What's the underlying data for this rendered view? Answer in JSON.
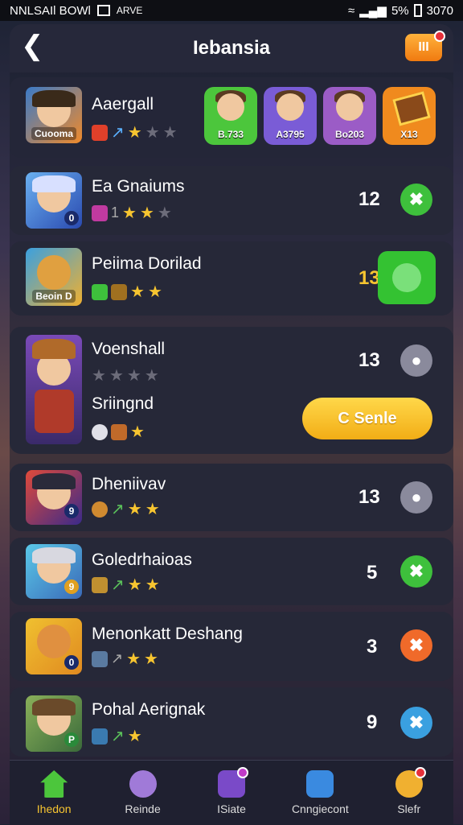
{
  "status_bar": {
    "left_text": "NNLSAIl BOWl",
    "small_text": "ARVE",
    "battery": "5%",
    "time": "3070"
  },
  "header": {
    "title": "Iebansia",
    "menu_label": "III"
  },
  "featured": {
    "name": "Aaergall",
    "badge": "Cuooma",
    "heroes": [
      {
        "label": "B.733",
        "color": "#4cc63c"
      },
      {
        "label": "A3795",
        "color": "#7a5cd6"
      },
      {
        "label": "Bo203",
        "color": "#9b5cc6"
      },
      {
        "label": "X13",
        "color": "#f08a1e"
      }
    ]
  },
  "players": [
    {
      "name": "Ea Gnaiums",
      "small": "1",
      "level": "12",
      "badge": "0"
    },
    {
      "name": "Peiima Dorilad",
      "level": "13",
      "badge": "Beoin D"
    },
    {
      "name": "Voenshall",
      "subtitle": "Sriingnd",
      "level": "13",
      "send_label": "C Senle",
      "badge": ""
    },
    {
      "name": "Dheniivav",
      "level": "13",
      "badge": "9"
    },
    {
      "name": "Goledrhaioas",
      "level": "5",
      "badge": "9"
    },
    {
      "name": "Menonkatt Deshang",
      "level": "3",
      "badge": "0"
    },
    {
      "name": "Pohal Aerignak",
      "level": "9",
      "badge": "P"
    }
  ],
  "nav": [
    {
      "label": "Ihedon",
      "icon": "home-icon"
    },
    {
      "label": "Reinde",
      "icon": "compass-icon"
    },
    {
      "label": "ISiate",
      "icon": "social-icon"
    },
    {
      "label": "Cnngiecont",
      "icon": "quest-icon"
    },
    {
      "label": "Slefr",
      "icon": "shop-icon"
    }
  ]
}
